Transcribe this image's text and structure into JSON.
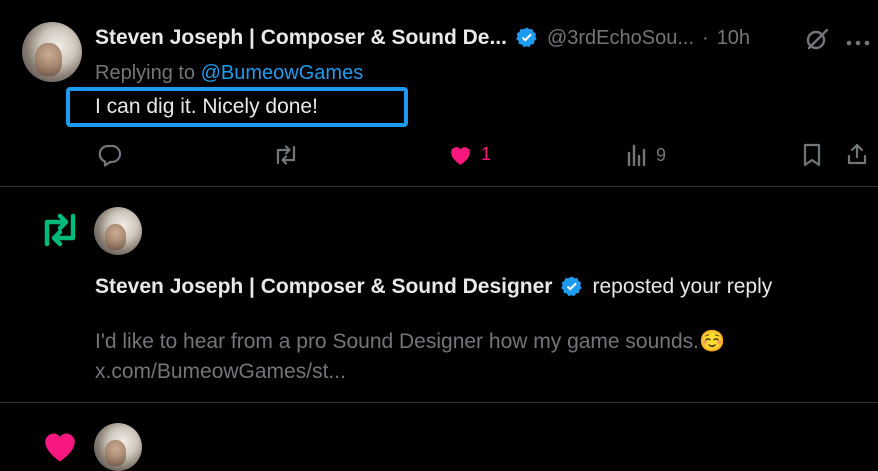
{
  "reply": {
    "author_name": "Steven Joseph | Composer & Sound De...",
    "handle": "@3rdEchoSou...",
    "separator": "·",
    "time": "10h",
    "replying_prefix": "Replying to",
    "replying_handle": "@BumeowGames",
    "text": "I can dig it. Nicely done!",
    "like_count": "1",
    "view_count": "9"
  },
  "repost_notification": {
    "author_name": "Steven Joseph | Composer & Sound Designer",
    "action_text": "reposted your reply",
    "quoted_text": "I'd like to hear from a pro Sound Designer how my game sounds.☺️",
    "quoted_link": "x.com/BumeowGames/st..."
  },
  "colors": {
    "accent": "#1d9bf0",
    "like": "#f91880",
    "repost": "#00ba7c",
    "muted": "#71767b",
    "text": "#e7e9ea",
    "divider": "#2f3336"
  },
  "icons": [
    "verified-badge-icon",
    "grok-icon",
    "more-icon",
    "reply-icon",
    "repost-icon",
    "like-icon",
    "views-icon",
    "bookmark-icon",
    "share-icon",
    "repost-notification-icon",
    "like-notification-icon"
  ]
}
